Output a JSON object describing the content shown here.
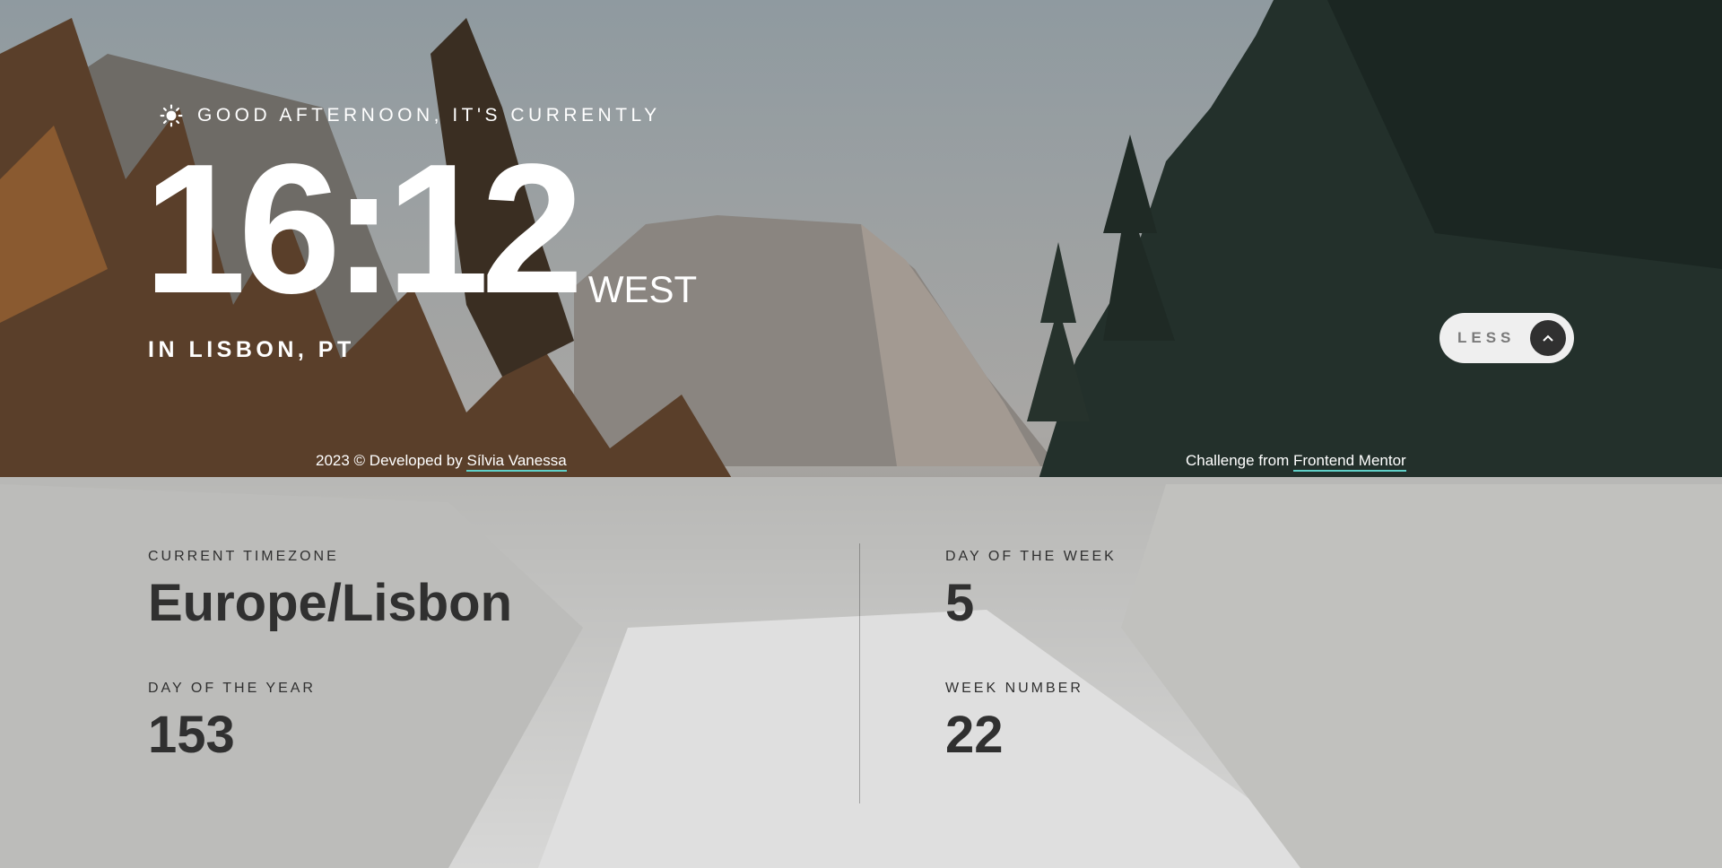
{
  "greeting": {
    "icon": "sun-icon",
    "text": "GOOD AFTERNOON, IT'S CURRENTLY"
  },
  "clock": {
    "time": "16:12",
    "abbreviation": "WEST",
    "location": "IN LISBON, PT"
  },
  "toggle": {
    "label": "LESS",
    "icon": "chevron-up-icon"
  },
  "footer": {
    "left_prefix": "2023 © Developed by ",
    "left_link": "Sílvia Vanessa",
    "right_prefix": "Challenge from ",
    "right_link": "Frontend Mentor",
    "link_underline_color": "#5fd0c8"
  },
  "details": {
    "timezone_label": "CURRENT TIMEZONE",
    "timezone_value": "Europe/Lisbon",
    "day_of_year_label": "DAY OF THE YEAR",
    "day_of_year_value": "153",
    "day_of_week_label": "DAY OF THE WEEK",
    "day_of_week_value": "5",
    "week_number_label": "WEEK NUMBER",
    "week_number_value": "22"
  },
  "colors": {
    "text_dark": "#303030",
    "panel_bg": "#dcdcdc",
    "button_bg": "#efefef",
    "accent": "#5fd0c8"
  }
}
